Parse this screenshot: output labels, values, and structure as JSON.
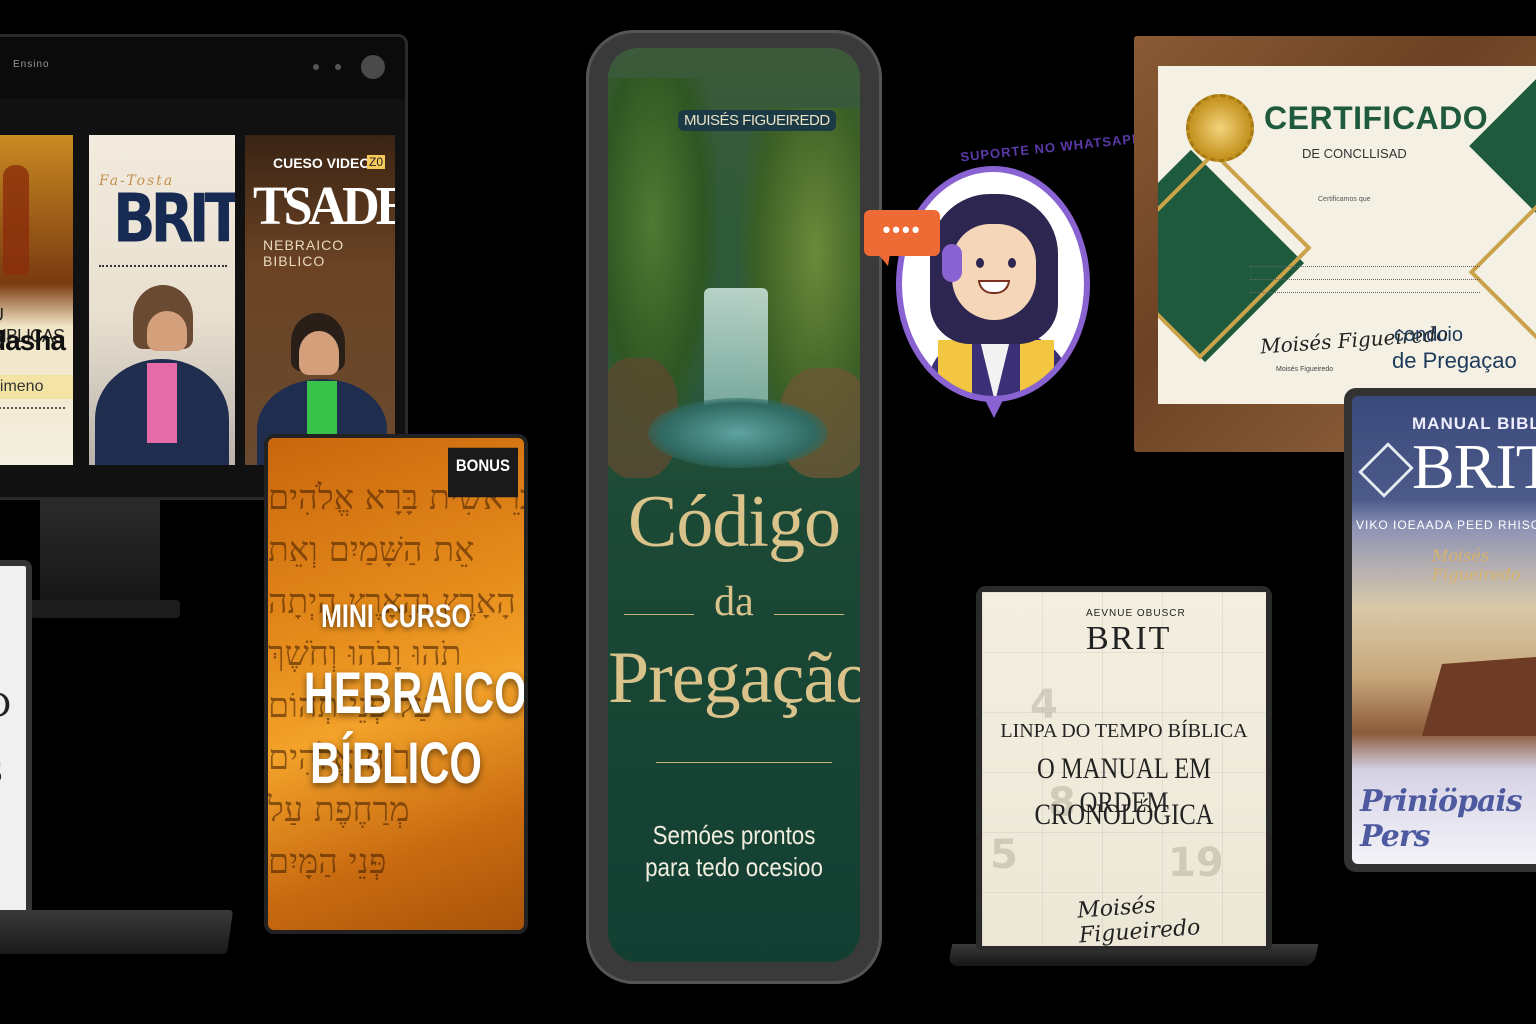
{
  "monitor": {
    "app_title": "Ensino",
    "cards": [
      {
        "line1": "U BIBLICAS",
        "line2": "dasha",
        "line3": "dimeno"
      },
      {
        "script": "Fa-Tosta",
        "title": "BRIT"
      },
      {
        "badge": "CUESO VIDEO",
        "badge2": "Z0",
        "title": "TSADE",
        "subtitle": "NEBRAICO BIBLICO"
      }
    ]
  },
  "left_laptop": {
    "mark1": "D",
    "mark2": "S"
  },
  "bonus_tablet": {
    "badge": "BONUS",
    "line1": "MINI CURSO",
    "line2": "HEBRAICO",
    "line3": "BÍBLICO",
    "hebrew_rows": [
      "בְּרֵאשִׁית בָּרָא אֱלֹהִים",
      "אֵת הַשָּׁמַיִם וְאֵת",
      "הָאָרֶץ וְהָאָרֶץ הָיְתָה",
      "תֹהוּ וָבֹהוּ וְחֹשֶׁךְ",
      "עַל פְּנֵי תְהוֹם",
      "וְרוּחַ אֱלֹהִים",
      "מְרַחֶפֶת עַל",
      "פְּנֵי הַמָּיִם"
    ]
  },
  "phone": {
    "author": "MUISÉS FIGUEIREDD",
    "title1": "Código",
    "title_connector": "da",
    "title2": "Pregação",
    "subtitle1": "Semóes prontos",
    "subtitle2": "para tedo ocesioo"
  },
  "support": {
    "arc_text": "SUPORTE NO WHATSAPP",
    "chat_dots": "••••"
  },
  "certificate": {
    "title": "CERTIFICADO",
    "subtitle": "DE CONCLLISAD",
    "tiny": "Certificamos que",
    "signature": "Moisés Figueiredo",
    "signature_caption": "Moisés Figueiredo",
    "brand1": "condcio",
    "brand2": "de Pregaçao"
  },
  "manual_tablet": {
    "top": "MANUAL BIBL",
    "brand": "BRIT",
    "line": "VIKO IOEAADA PEED RHISON",
    "script": "Moisés Figueiredo",
    "footer": "Priniöpais Pers"
  },
  "center_laptop": {
    "small": "AEVNUE OBUSCR",
    "brand": "BRIT",
    "line1": "LINPA DO TEMPO BÍBLICA",
    "line2": "O MANUAL EM ORDEM",
    "line3": "CRONOLÓGICA",
    "calendar_numbers": [
      "4",
      "8",
      "5",
      "19"
    ],
    "signature": "Moisés Figueiredo"
  }
}
